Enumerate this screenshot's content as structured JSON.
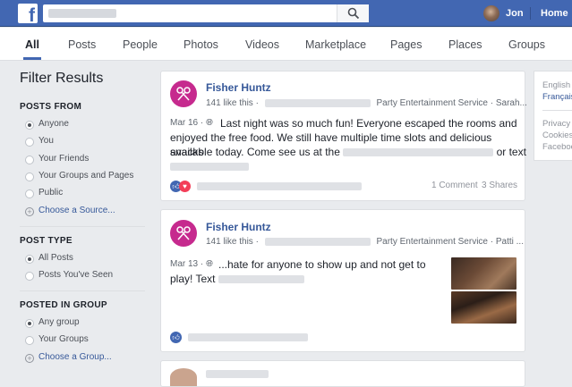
{
  "topbar": {
    "logo": "f",
    "search_placeholder": "",
    "user": "Jon",
    "home": "Home",
    "brand_color": "#4267b2"
  },
  "tabs": [
    "All",
    "Posts",
    "People",
    "Photos",
    "Videos",
    "Marketplace",
    "Pages",
    "Places",
    "Groups"
  ],
  "filter": {
    "title": "Filter Results",
    "posts_from": {
      "heading": "POSTS FROM",
      "options": [
        "Anyone",
        "You",
        "Your Friends",
        "Your Groups and Pages",
        "Public"
      ],
      "selected": "Anyone",
      "choose": "Choose a Source..."
    },
    "post_type": {
      "heading": "POST TYPE",
      "options": [
        "All Posts",
        "Posts You've Seen"
      ],
      "selected": "All Posts"
    },
    "posted_in_group": {
      "heading": "POSTED IN GROUP",
      "options": [
        "Any group",
        "Your Groups"
      ],
      "selected": "Any group",
      "choose": "Choose a Group..."
    }
  },
  "posts": [
    {
      "author": "Fisher Huntz",
      "likes": "141 like this ·",
      "category": "Party Entertainment Service · Sarah...",
      "date": "Mar 16 ·",
      "text_1": "Last night was so much fun! Everyone escaped the rooms and",
      "text_2": "enjoyed the free food. We still have multiple time slots and delicious snacks",
      "text_3a": "available today. Come see us at the",
      "text_3b": "or text",
      "comments": "1 Comment",
      "shares": "3 Shares"
    },
    {
      "author": "Fisher Huntz",
      "likes": "141 like this ·",
      "category": "Party Entertainment Service · Patti ...",
      "date": "Mar 13 ·",
      "text_1": "...hate for anyone to show up and not get to",
      "text_2": "play! Text"
    }
  ],
  "right_panel": {
    "lang_1": "English",
    "lang_2": "Français",
    "footer_1": "Privacy",
    "footer_2": "Cookies",
    "footer_3": "Facebook"
  }
}
